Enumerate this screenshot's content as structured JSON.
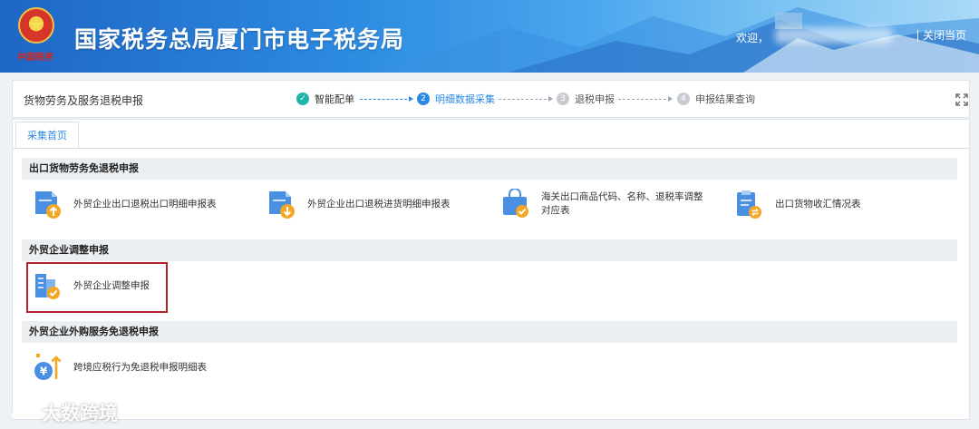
{
  "header": {
    "emblem_motto": "中国税务",
    "title": "国家税务总局厦门市电子税务局",
    "welcome_label": "欢迎，",
    "close_label": "关闭当页"
  },
  "stepbar": {
    "crumb": "货物劳务及服务退税申报",
    "steps": [
      {
        "num": "✓",
        "label": "智能配单",
        "state": "done"
      },
      {
        "num": "2",
        "label": "明细数据采集",
        "state": "active"
      },
      {
        "num": "3",
        "label": "退税申报",
        "state": "todo"
      },
      {
        "num": "4",
        "label": "申报结果查询",
        "state": "todo"
      }
    ]
  },
  "tab": {
    "label": "采集首页"
  },
  "sections": [
    {
      "title": "出口货物劳务免退税申报",
      "items": [
        {
          "label": "外贸企业出口退税出口明细申报表",
          "icon": "document-upload-icon"
        },
        {
          "label": "外贸企业出口退税进货明细申报表",
          "icon": "document-download-icon"
        },
        {
          "label": "海关出口商品代码、名称、退税率调整对应表",
          "label_line1": "海关出口商品代码、名称、退税率调整",
          "label_line2": "对应表",
          "icon": "shopping-bag-check-icon"
        },
        {
          "label": "出口货物收汇情况表",
          "icon": "clipboard-exchange-icon"
        }
      ]
    },
    {
      "title": "外贸企业调整申报",
      "items": [
        {
          "label": "外贸企业调整申报",
          "icon": "building-check-icon"
        }
      ]
    },
    {
      "title": "外贸企业外购服务免退税申报",
      "items": [
        {
          "label": "跨境应税行为免退税申报明细表",
          "icon": "yuan-coin-arrow-icon"
        }
      ]
    }
  ],
  "watermark": {
    "text": "大数跨境"
  },
  "colors": {
    "accent": "#2c89e6",
    "done": "#1fb5a8",
    "icon_blue": "#4a90e2",
    "icon_orange": "#f5a623",
    "highlight": "#b2242a"
  }
}
